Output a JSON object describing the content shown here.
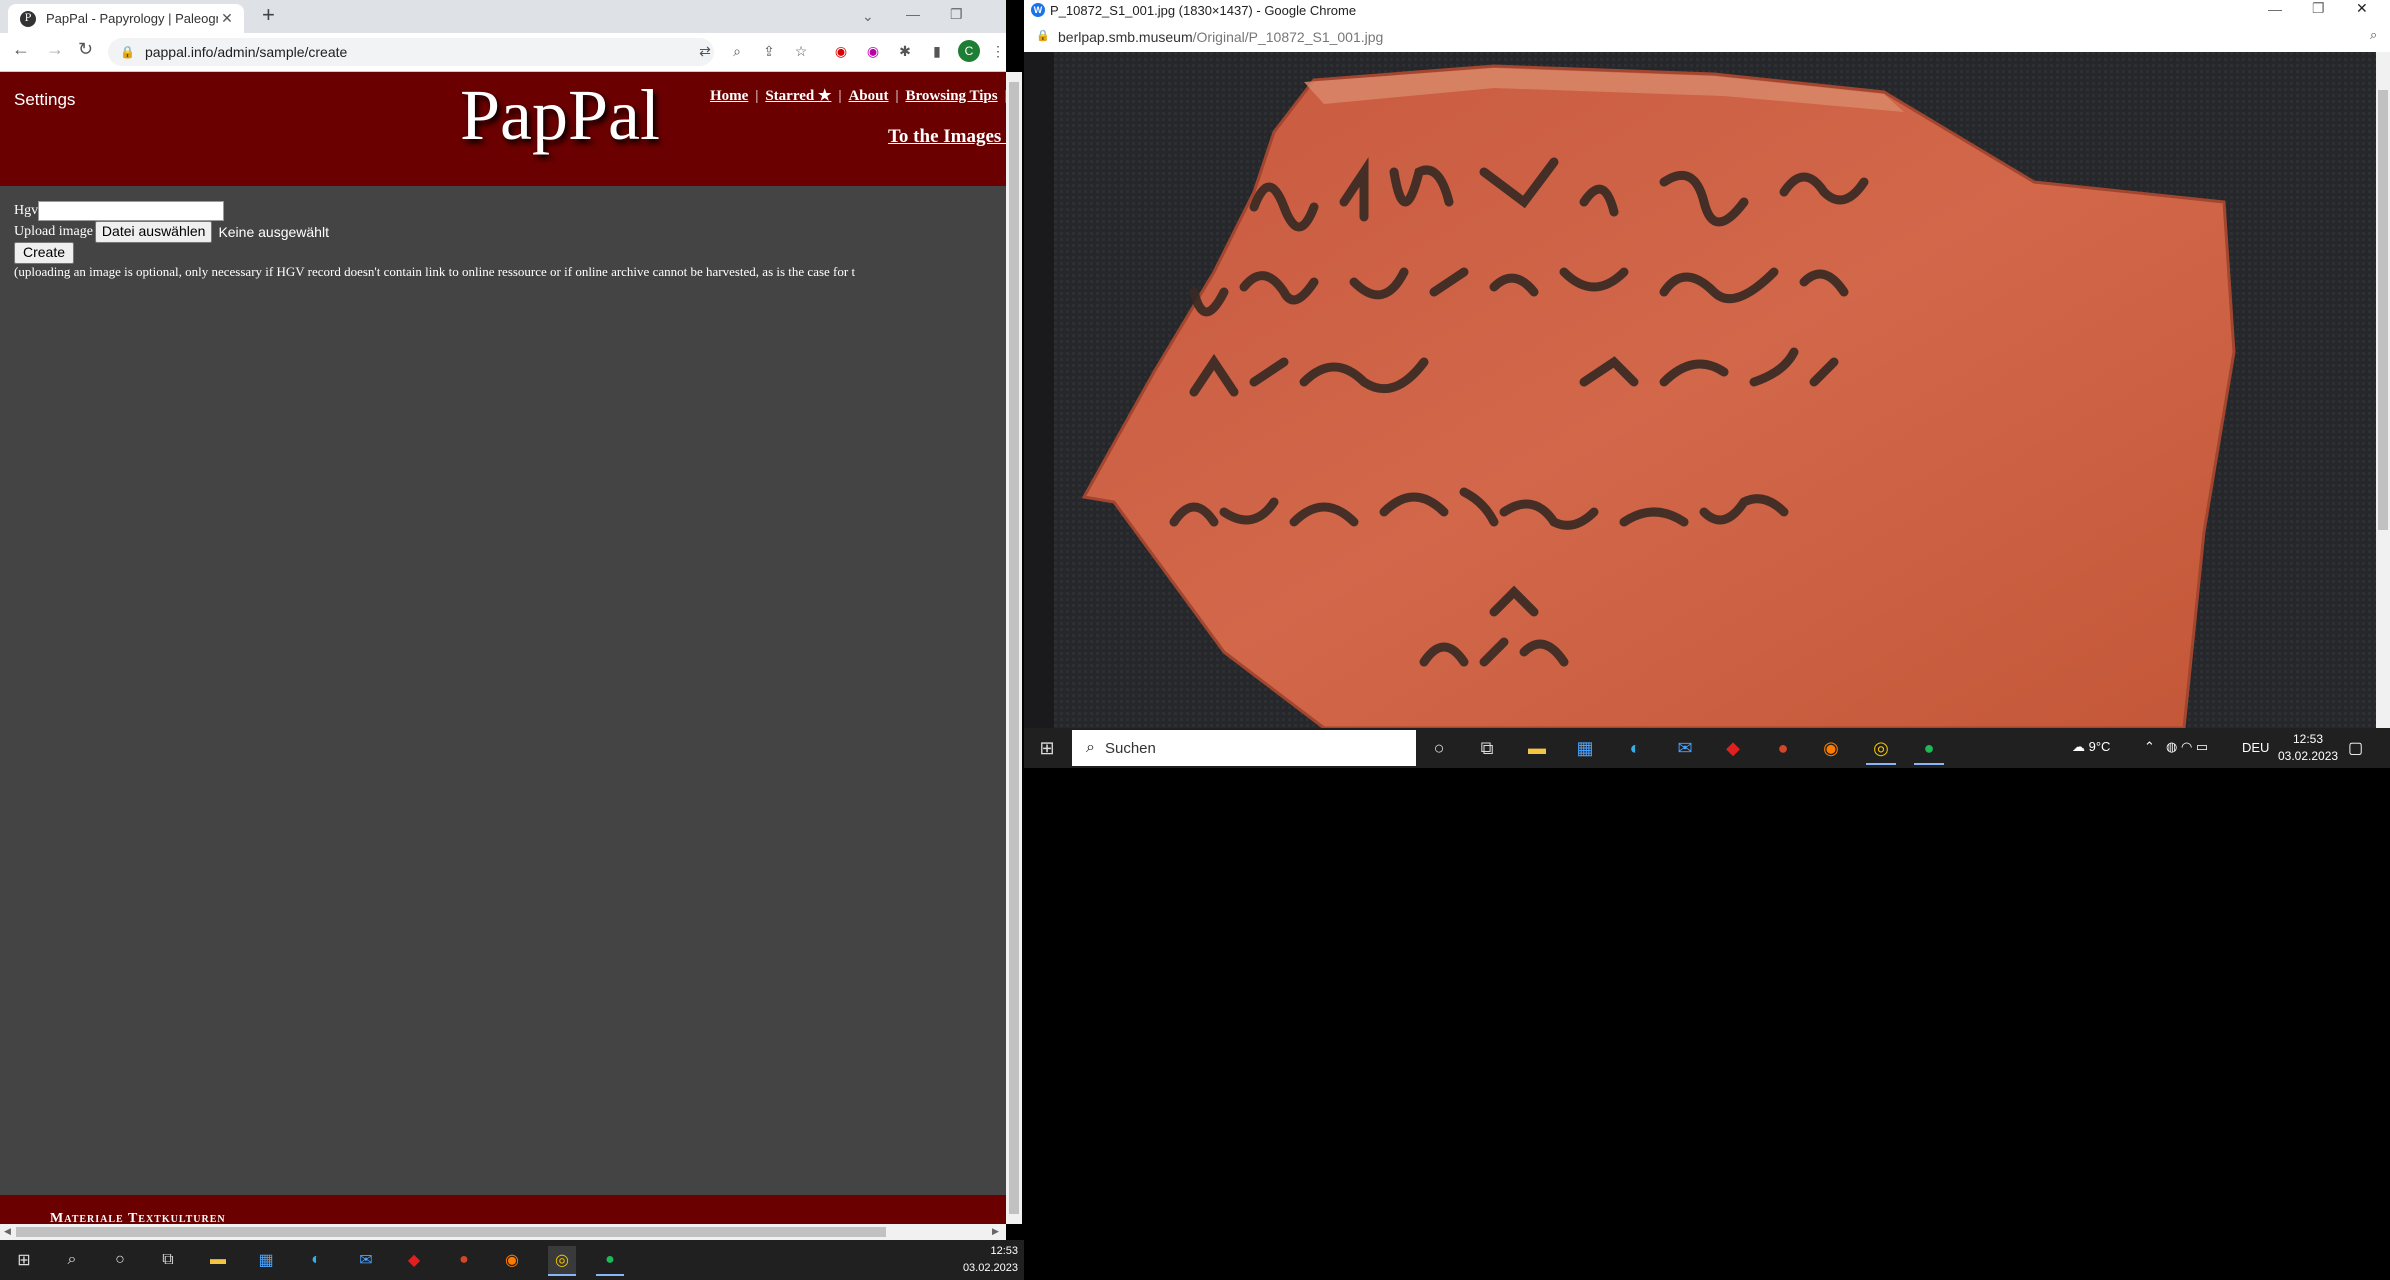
{
  "left_window": {
    "tab_title": "PapPal - Papyrology | Paleograph",
    "tab_favicon": "P",
    "url": "pappal.info/admin/sample/create",
    "avatar_letter": "C",
    "page": {
      "settings_link": "Settings",
      "logo": "PapPal",
      "nav": [
        {
          "label": "Home"
        },
        {
          "label": "Starred ★"
        },
        {
          "label": "About"
        },
        {
          "label": "Browsing Tips"
        }
      ],
      "nav_sep": "|",
      "images_link": "To the Images ...",
      "form": {
        "hgv_label": "Hgv",
        "hgv_value": "",
        "upload_label": "Upload image",
        "file_button": "Datei auswählen",
        "file_status": "Keine ausgewählt",
        "create_button": "Create",
        "note": "(uploading an image is optional, only necessary if HGV record doesn't contain link to online ressource or if online archive cannot be harvested, as is the case for t"
      },
      "footer_text": "Materiale Textkulturen"
    }
  },
  "right_window": {
    "title": "P_10872_S1_001.jpg (1830×1437) - Google Chrome",
    "url_host": "berlpap.smb.museum",
    "url_path": "/Original/P_10872_S1_001.jpg"
  },
  "taskbar_big": {
    "search_placeholder": "Suchen",
    "weather": "9°C",
    "lang": "DEU",
    "time": "12:53",
    "date": "03.02.2023"
  },
  "taskbar_small": {
    "time": "12:53",
    "date": "03.02.2023"
  },
  "colors": {
    "pappal_red": "#6b0000",
    "page_bg": "#444444",
    "taskbar": "#202020"
  }
}
